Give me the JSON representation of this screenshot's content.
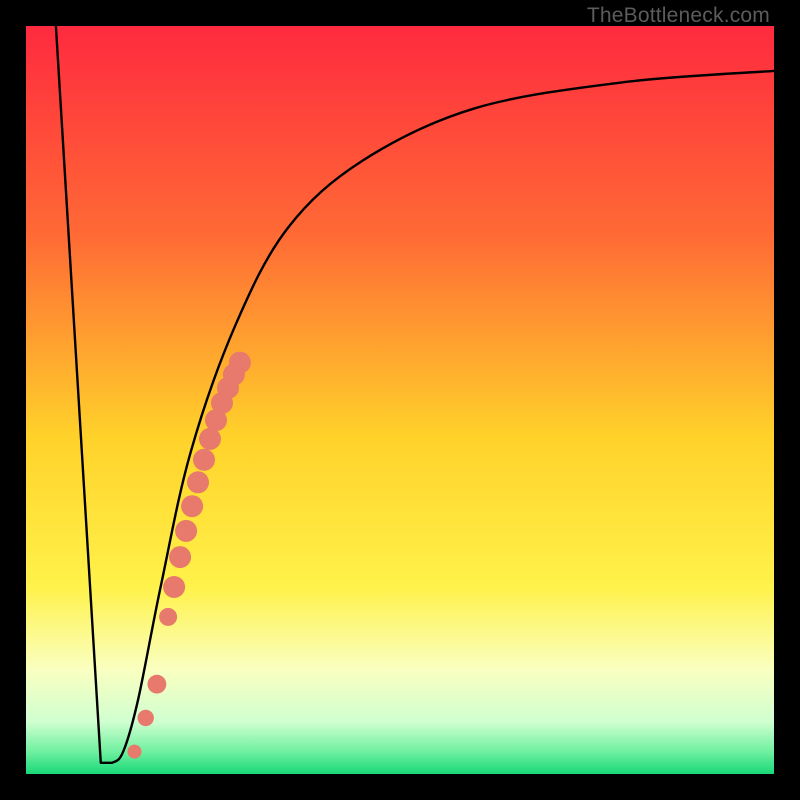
{
  "attribution": "TheBottleneck.com",
  "colors": {
    "frame": "#000000",
    "curve": "#000000",
    "highlight": "#e77a6d",
    "gradient_top": "#ff2a3f",
    "gradient_mid1": "#ff8a2a",
    "gradient_mid2": "#ffe52a",
    "gradient_mid3": "#f8ffb0",
    "gradient_mid4": "#c8ffc8",
    "gradient_bottom": "#18e07a"
  },
  "chart_data": {
    "type": "line",
    "title": "",
    "xlabel": "",
    "ylabel": "",
    "xlim": [
      0,
      100
    ],
    "ylim": [
      0,
      100
    ],
    "series": [
      {
        "name": "bottleneck-curve",
        "x": [
          4,
          10,
          11.5,
          13,
          15,
          18,
          22,
          28,
          35,
          45,
          60,
          80,
          100
        ],
        "y": [
          100,
          1.5,
          1.5,
          3,
          10,
          25,
          43,
          60,
          73,
          82,
          89,
          92.5,
          94
        ]
      }
    ],
    "highlight_points": {
      "name": "highlighted-range",
      "x": [
        14.5,
        16.0,
        17.5,
        19.0,
        19.8,
        20.6,
        21.4,
        22.2,
        23.0,
        23.8,
        24.6,
        25.4,
        26.2,
        27.0,
        27.8,
        28.6
      ],
      "y": [
        3.0,
        7.5,
        12.0,
        21.0,
        25.0,
        29.0,
        32.5,
        35.8,
        39.0,
        42.0,
        44.8,
        47.3,
        49.6,
        51.6,
        53.4,
        55.0
      ]
    }
  }
}
